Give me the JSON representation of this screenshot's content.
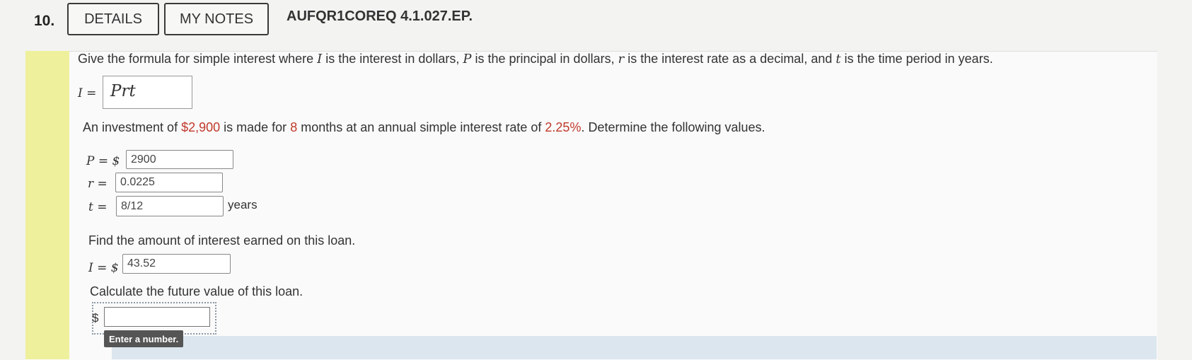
{
  "header": {
    "question_number": "10.",
    "details_label": "DETAILS",
    "notes_label": "MY NOTES",
    "question_id": "AUFQR1COREQ 4.1.027.EP."
  },
  "intro": {
    "t1": "Give the formula for simple interest where ",
    "v_I": "I",
    "t2": " is the interest in dollars, ",
    "v_P": "P",
    "t3": " is the principal in dollars, ",
    "v_r": "r",
    "t4": " is the interest rate as a decimal, and ",
    "v_t": "t",
    "t5": " is the time period in years."
  },
  "formula": {
    "lhs": "I =",
    "answer": "Prt"
  },
  "investment": {
    "t1": "An investment of ",
    "amount": "$2,900",
    "t2": " is made for ",
    "months": "8",
    "t3": " months at an annual simple interest rate of ",
    "rate": "2.25%",
    "t4": ". Determine the following values."
  },
  "values": {
    "p_label": "P = $",
    "p_value": "2900",
    "r_label": "r =",
    "r_value": "0.0225",
    "t_label": "t =",
    "t_value": "8/12",
    "t_unit": "years"
  },
  "interest": {
    "prompt": "Find the amount of interest earned on this loan.",
    "label": "I = $",
    "value": "43.52"
  },
  "future": {
    "prompt": "Calculate the future value of this loan.",
    "currency": "$",
    "tooltip": "Enter a number."
  }
}
